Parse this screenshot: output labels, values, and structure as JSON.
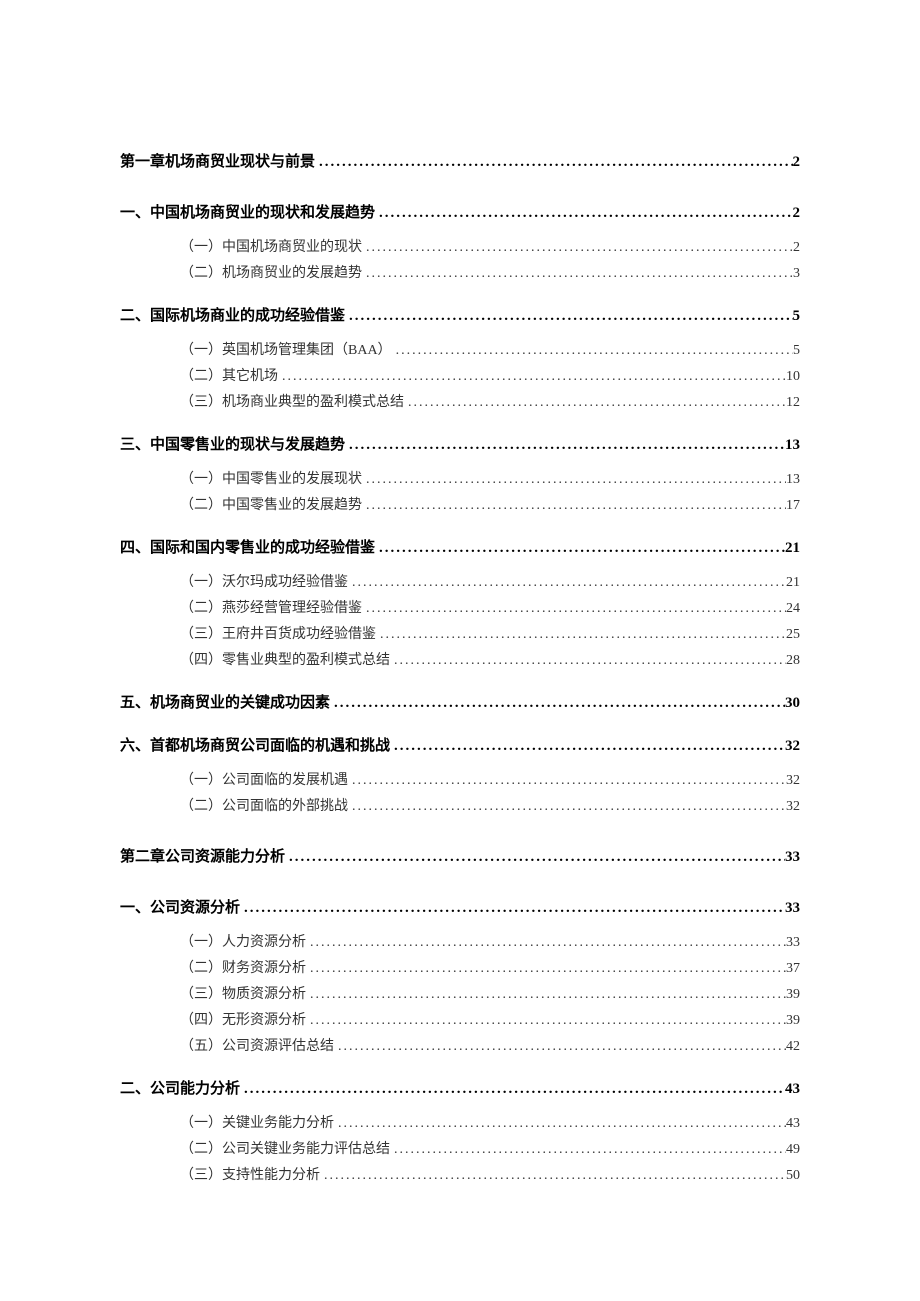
{
  "toc": [
    {
      "level": 1,
      "title": "第一章机场商贸业现状与前景",
      "page": "2"
    },
    {
      "level": 2,
      "title": "一、中国机场商贸业的现状和发展趋势",
      "page": "2"
    },
    {
      "level": 3,
      "title": "（一）中国机场商贸业的现状",
      "page": "2"
    },
    {
      "level": 3,
      "title": "（二）机场商贸业的发展趋势",
      "page": "3"
    },
    {
      "level": 2,
      "title": "二、国际机场商业的成功经验借鉴",
      "page": "5"
    },
    {
      "level": 3,
      "title": "（一）英国机场管理集团（BAA）",
      "page": "5"
    },
    {
      "level": 3,
      "title": "（二）其它机场",
      "page": "10"
    },
    {
      "level": 3,
      "title": "（三）机场商业典型的盈利模式总结",
      "page": "12"
    },
    {
      "level": 2,
      "title": "三、中国零售业的现状与发展趋势",
      "page": "13"
    },
    {
      "level": 3,
      "title": "（一）中国零售业的发展现状",
      "page": "13"
    },
    {
      "level": 3,
      "title": "（二）中国零售业的发展趋势",
      "page": "17"
    },
    {
      "level": 2,
      "title": "四、国际和国内零售业的成功经验借鉴",
      "page": "21"
    },
    {
      "level": 3,
      "title": "（一）沃尔玛成功经验借鉴",
      "page": "21"
    },
    {
      "level": 3,
      "title": "（二）燕莎经营管理经验借鉴",
      "page": "24"
    },
    {
      "level": 3,
      "title": "（三）王府井百货成功经验借鉴",
      "page": "25"
    },
    {
      "level": 3,
      "title": "（四）零售业典型的盈利模式总结",
      "page": "28"
    },
    {
      "level": 2,
      "title": "五、机场商贸业的关键成功因素",
      "page": "30"
    },
    {
      "level": 2,
      "title": "六、首都机场商贸公司面临的机遇和挑战",
      "page": "32"
    },
    {
      "level": 3,
      "title": "（一）公司面临的发展机遇",
      "page": "32"
    },
    {
      "level": 3,
      "title": "（二）公司面临的外部挑战",
      "page": "32"
    },
    {
      "level": 1,
      "title": "第二章公司资源能力分析",
      "page": "33"
    },
    {
      "level": 2,
      "title": "一、公司资源分析",
      "page": "33"
    },
    {
      "level": 3,
      "title": "（一）人力资源分析",
      "page": "33"
    },
    {
      "level": 3,
      "title": "（二）财务资源分析",
      "page": "37"
    },
    {
      "level": 3,
      "title": "（三）物质资源分析",
      "page": "39"
    },
    {
      "level": 3,
      "title": "（四）无形资源分析",
      "page": "39"
    },
    {
      "level": 3,
      "title": "（五）公司资源评估总结",
      "page": "42"
    },
    {
      "level": 2,
      "title": "二、公司能力分析",
      "page": "43"
    },
    {
      "level": 3,
      "title": "（一）关键业务能力分析",
      "page": "43"
    },
    {
      "level": 3,
      "title": "（二）公司关键业务能力评估总结",
      "page": "49"
    },
    {
      "level": 3,
      "title": "（三）支持性能力分析",
      "page": "50"
    }
  ]
}
